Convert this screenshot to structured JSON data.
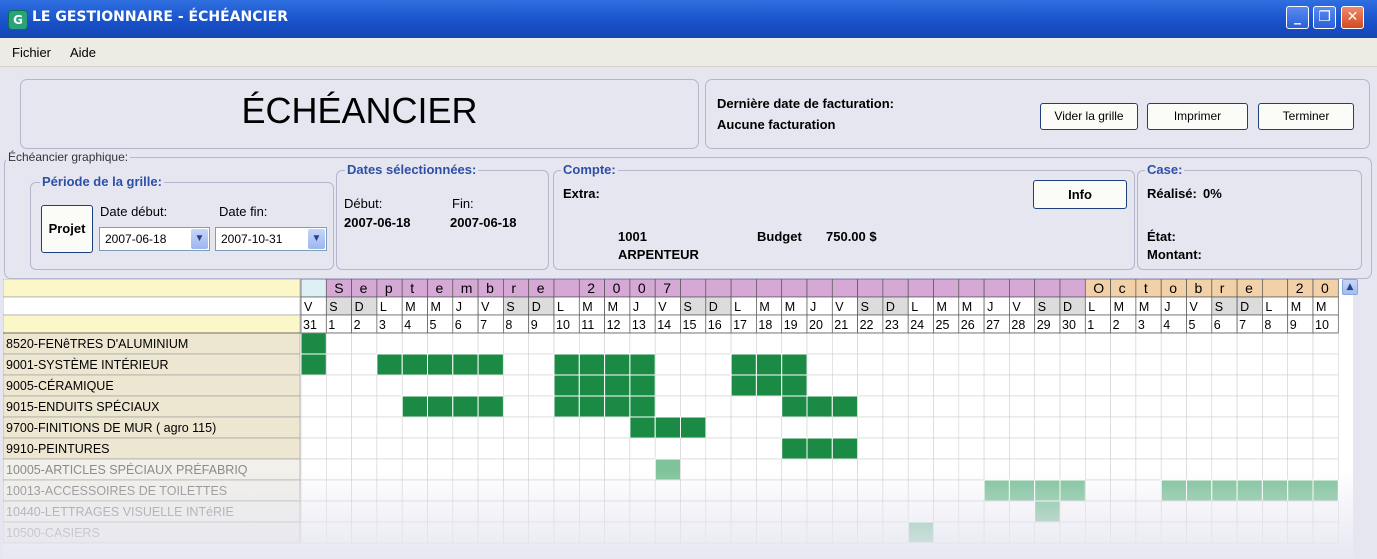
{
  "window": {
    "title": "LE GESTIONNAIRE - ÉCHÉANCIER",
    "icon": "G"
  },
  "window_controls": {
    "minimize": "_",
    "restore": "❐",
    "close": "✕"
  },
  "menu": [
    "Fichier",
    "Aide"
  ],
  "header": {
    "title": "ÉCHÉANCIER",
    "billing_label": "Dernière date de facturation:",
    "billing_value": "Aucune facturation",
    "buttons": {
      "clear": "Vider la grille",
      "print": "Imprimer",
      "finish": "Terminer"
    }
  },
  "graph": {
    "legend": "Échéancier graphique:",
    "period": {
      "legend": "Période de la grille:",
      "project_button": "Projet",
      "start_label": "Date début:",
      "end_label": "Date fin:",
      "start_value": "2007-06-18",
      "end_value": "2007-10-31"
    },
    "selected": {
      "legend": "Dates sélectionnées:",
      "start_label": "Début:",
      "end_label": "Fin:",
      "start_value": "2007-06-18",
      "end_value": "2007-06-18"
    },
    "account": {
      "legend": "Compte:",
      "extra_label": "Extra:",
      "info_button": "Info",
      "number": "1001",
      "name": "ARPENTEUR",
      "budget_label": "Budget",
      "budget_value": "750.00 $"
    },
    "cell": {
      "legend": "Case:",
      "done_label": "Réalisé:",
      "done_value": "0%",
      "state_label": "État:",
      "amount_label": "Montant:"
    }
  },
  "colors": {
    "filled": "#1b8a45",
    "filled_light": "#7ec39a",
    "month_sep": "#d6a8d6",
    "month_oct": "#f2d1a8",
    "label_header": "#fbf7c8",
    "row_label": "#ede7d2",
    "weekend": "#dcdcdc"
  },
  "timeline": {
    "month_letters": [
      {
        "col": 1,
        "text": "S",
        "month": "sep"
      },
      {
        "col": 2,
        "text": "e",
        "month": "sep"
      },
      {
        "col": 3,
        "text": "p",
        "month": "sep"
      },
      {
        "col": 4,
        "text": "t",
        "month": "sep"
      },
      {
        "col": 5,
        "text": "e",
        "month": "sep"
      },
      {
        "col": 6,
        "text": "m",
        "month": "sep"
      },
      {
        "col": 7,
        "text": "b",
        "month": "sep"
      },
      {
        "col": 8,
        "text": "r",
        "month": "sep"
      },
      {
        "col": 9,
        "text": "e",
        "month": "sep"
      },
      {
        "col": 11,
        "text": "2",
        "month": "sep"
      },
      {
        "col": 12,
        "text": "0",
        "month": "sep"
      },
      {
        "col": 13,
        "text": "0",
        "month": "sep"
      },
      {
        "col": 14,
        "text": "7",
        "month": "sep"
      },
      {
        "col": 31,
        "text": "O",
        "month": "oct"
      },
      {
        "col": 32,
        "text": "c",
        "month": "oct"
      },
      {
        "col": 33,
        "text": "t",
        "month": "oct"
      },
      {
        "col": 34,
        "text": "o",
        "month": "oct"
      },
      {
        "col": 35,
        "text": "b",
        "month": "oct"
      },
      {
        "col": 36,
        "text": "r",
        "month": "oct"
      },
      {
        "col": 37,
        "text": "e",
        "month": "oct"
      },
      {
        "col": 39,
        "text": "2",
        "month": "oct"
      },
      {
        "col": 40,
        "text": "0",
        "month": "oct"
      }
    ],
    "weekdays": [
      "V",
      "S",
      "D",
      "L",
      "M",
      "M",
      "J",
      "V",
      "S",
      "D",
      "L",
      "M",
      "M",
      "J",
      "V",
      "S",
      "D",
      "L",
      "M",
      "M",
      "J",
      "V",
      "S",
      "D",
      "L",
      "M",
      "M",
      "J",
      "V",
      "S",
      "D",
      "L",
      "M",
      "M",
      "J",
      "V",
      "S",
      "D",
      "L",
      "M",
      "M"
    ],
    "days": [
      "31",
      "1",
      "2",
      "3",
      "4",
      "5",
      "6",
      "7",
      "8",
      "9",
      "10",
      "11",
      "12",
      "13",
      "14",
      "15",
      "16",
      "17",
      "18",
      "19",
      "20",
      "21",
      "22",
      "23",
      "24",
      "25",
      "26",
      "27",
      "28",
      "29",
      "30",
      "1",
      "2",
      "3",
      "4",
      "5",
      "6",
      "7",
      "8",
      "9",
      "10"
    ],
    "month_groups": [
      "aug",
      "sep",
      "sep",
      "sep",
      "sep",
      "sep",
      "sep",
      "sep",
      "sep",
      "sep",
      "sep",
      "sep",
      "sep",
      "sep",
      "sep",
      "sep",
      "sep",
      "sep",
      "sep",
      "sep",
      "sep",
      "sep",
      "sep",
      "sep",
      "sep",
      "sep",
      "sep",
      "sep",
      "sep",
      "sep",
      "sep",
      "oct",
      "oct",
      "oct",
      "oct",
      "oct",
      "oct",
      "oct",
      "oct",
      "oct",
      "oct"
    ]
  },
  "rows": [
    {
      "label": "8520-FENêTRES D'ALUMINIUM",
      "filled": [
        0
      ],
      "faded": false
    },
    {
      "label": "9001-SYSTÈME INTÉRIEUR",
      "filled": [
        0,
        3,
        4,
        5,
        6,
        7,
        10,
        11,
        12,
        13,
        17,
        18,
        19
      ],
      "faded": false
    },
    {
      "label": "9005-CÉRAMIQUE",
      "filled": [
        10,
        11,
        12,
        13,
        17,
        18,
        19
      ],
      "faded": false
    },
    {
      "label": "9015-ENDUITS SPÉCIAUX",
      "filled": [
        4,
        5,
        6,
        7,
        10,
        11,
        12,
        13,
        19,
        20,
        21
      ],
      "faded": false
    },
    {
      "label": "9700-FINITIONS DE MUR  ( agro 115)",
      "filled": [
        13,
        14,
        15
      ],
      "faded": false
    },
    {
      "label": "9910-PEINTURES",
      "filled": [
        19,
        20,
        21
      ],
      "faded": false
    },
    {
      "label": "10005-ARTICLES SPÉCIAUX PRÉFABRIQ",
      "filled": [
        14
      ],
      "faded": true
    },
    {
      "label": "10013-ACCESSOIRES DE TOILETTES",
      "filled": [
        27,
        28,
        29,
        30,
        34,
        35,
        36,
        37,
        38,
        39,
        40
      ],
      "faded": true
    },
    {
      "label": "10440-LETTRAGES  VISUELLE INTéRIE",
      "filled": [
        29
      ],
      "faded": true
    },
    {
      "label": "10500-CASIERS",
      "filled": [
        24
      ],
      "faded": true
    }
  ]
}
